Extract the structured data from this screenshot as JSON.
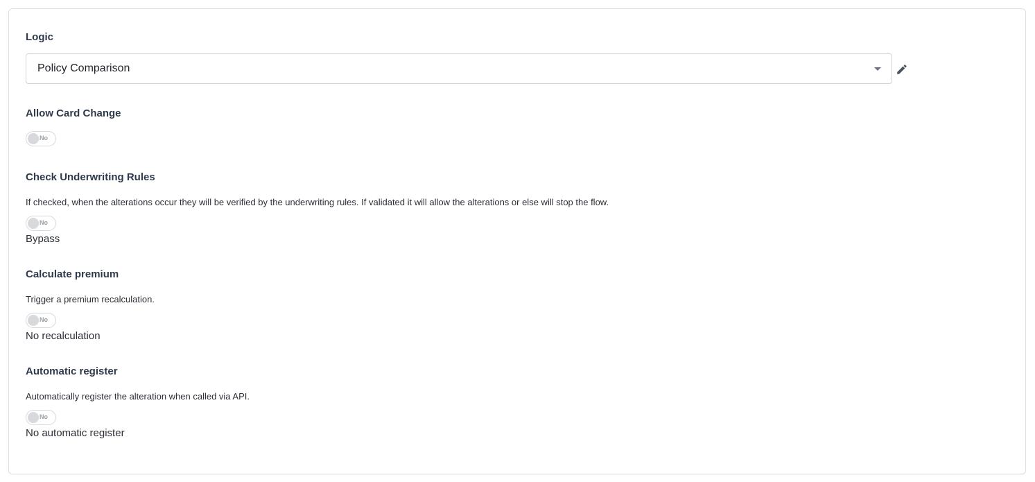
{
  "logic": {
    "label": "Logic",
    "selected": "Policy Comparison"
  },
  "allow_card_change": {
    "label": "Allow Card Change",
    "toggle_text": "No"
  },
  "check_underwriting": {
    "label": "Check Underwriting Rules",
    "description": "If checked, when the alterations occur they will be verified by the underwriting rules. If validated it will allow the alterations or else will stop the flow.",
    "toggle_text": "No",
    "status": "Bypass"
  },
  "calculate_premium": {
    "label": "Calculate premium",
    "description": "Trigger a premium recalculation.",
    "toggle_text": "No",
    "status": "No recalculation"
  },
  "automatic_register": {
    "label": "Automatic register",
    "description": "Automatically register the alteration when called via API.",
    "toggle_text": "No",
    "status": "No automatic register"
  },
  "icons": {
    "select_caret": "chevron-down-icon",
    "edit": "pencil-icon"
  },
  "colors": {
    "text_heading": "#2f3a4b",
    "border": "#cfd4db",
    "toggle_off": "#d7d9dc"
  }
}
